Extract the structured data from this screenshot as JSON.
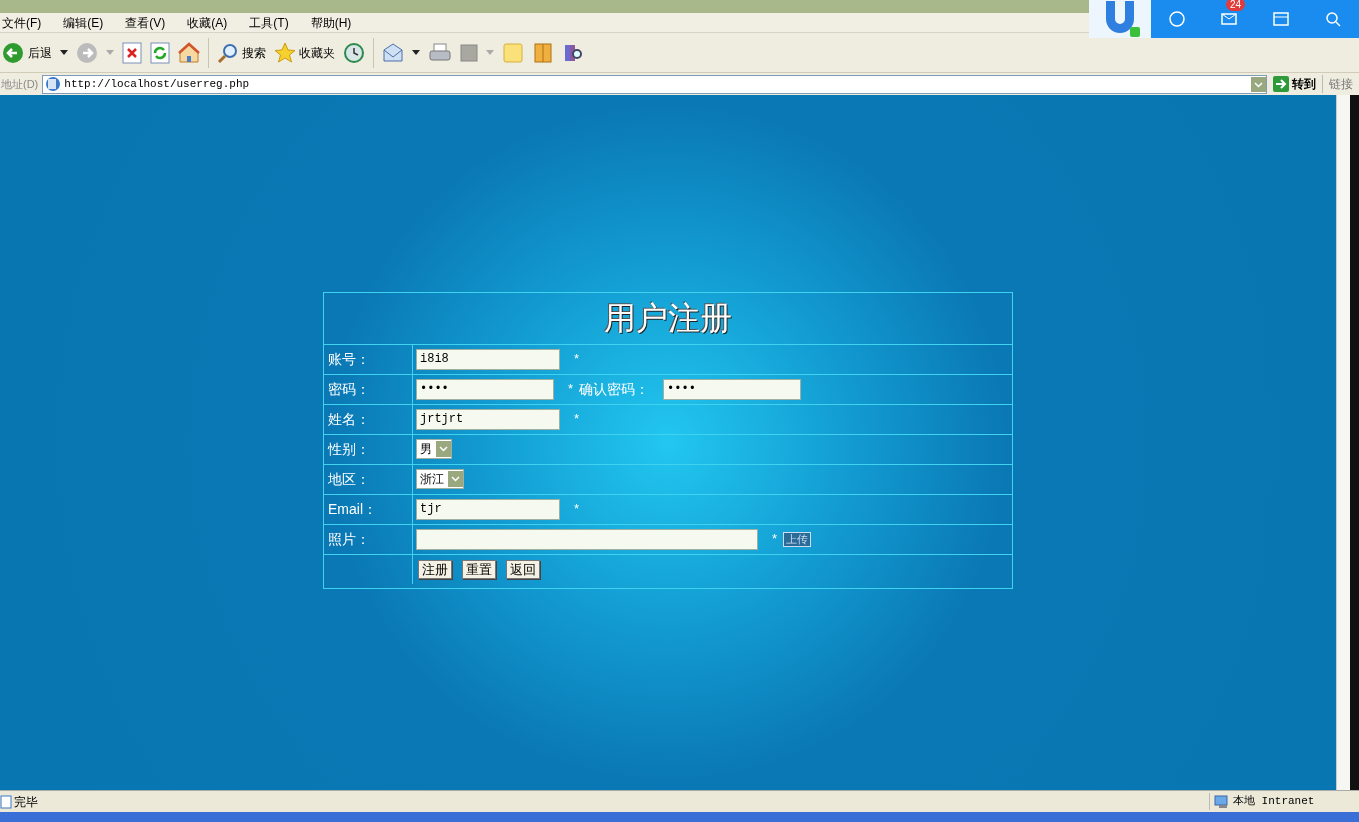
{
  "menu": [
    "文件(F)",
    "编辑(E)",
    "查看(V)",
    "收藏(A)",
    "工具(T)",
    "帮助(H)"
  ],
  "toolbar": {
    "back": "后退",
    "search": "搜索",
    "favorites": "收藏夹"
  },
  "address": {
    "label": "地址(D)",
    "url": "http://localhost/userreg.php",
    "go": "转到",
    "links": "链接"
  },
  "widget": {
    "badge": "24"
  },
  "form": {
    "title": "用户注册",
    "rows": [
      {
        "kind": "text",
        "label": "账号：",
        "value": "i8i8",
        "required": "*"
      },
      {
        "kind": "password_pair",
        "label": "密码：",
        "value": "••••",
        "required": "*",
        "confirm_label": "确认密码：",
        "confirm_value": "••••"
      },
      {
        "kind": "text",
        "label": "姓名：",
        "value": "jrtjrt",
        "required": "*"
      },
      {
        "kind": "select",
        "label": "性别：",
        "value": "男"
      },
      {
        "kind": "select",
        "label": "地区：",
        "value": "浙江"
      },
      {
        "kind": "text",
        "label": "Email：",
        "value": "tjr",
        "required": "*"
      },
      {
        "kind": "file",
        "label": "照片：",
        "required": "*",
        "button": "上传"
      }
    ],
    "buttons": [
      "注册",
      "重置",
      "返回"
    ]
  },
  "status_bar": {
    "text": "完毕",
    "zone": "本地 Intranet"
  }
}
